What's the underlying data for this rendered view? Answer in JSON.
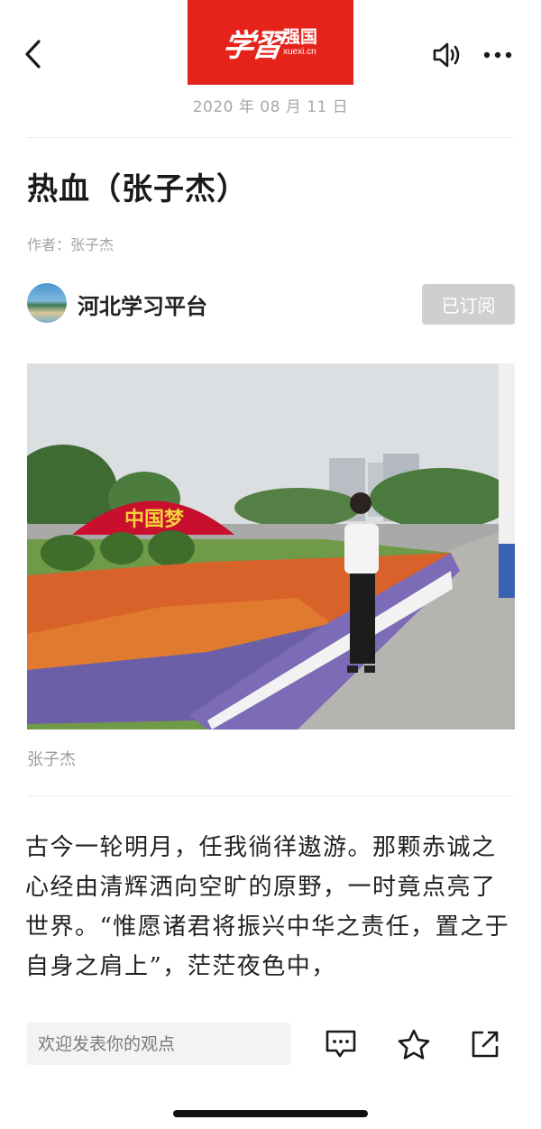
{
  "header": {
    "logo_calligraphy": "学習",
    "logo_name": "强国",
    "logo_domain": "xuexi.cn",
    "date": "2020 年 08 月 11 日",
    "brand_color": "#e5231b"
  },
  "article": {
    "title": "热血（张子杰）",
    "author": "作者：张子杰",
    "channel_name": "河北学习平台",
    "subscribe_label": "已订阅",
    "photo_sign": "中国梦",
    "photo_caption": "张子杰",
    "body": "古今一轮明月，任我徜徉遨游。那颗赤诚之心经由清辉洒向空旷的原野，一时竟点亮了世界。“惟愿诸君将振兴中华之责任，置之于自身之肩上”，茫茫夜色中，"
  },
  "bottom_bar": {
    "comment_placeholder": "欢迎发表你的观点"
  },
  "icons": [
    "back-icon",
    "speaker-icon",
    "more-icon",
    "comment-icon",
    "star-icon",
    "share-icon"
  ]
}
